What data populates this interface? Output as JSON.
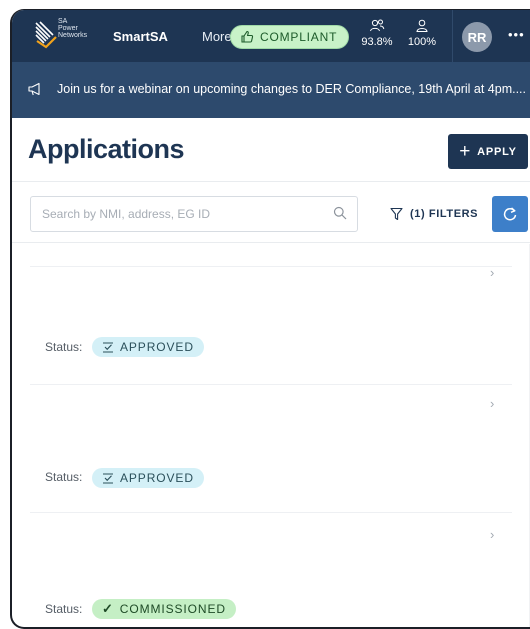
{
  "header": {
    "logo_text": [
      "SA",
      "Power",
      "Networks"
    ],
    "app_name": "SmartSA",
    "more_label": "More",
    "compliant_label": "COMPLIANT",
    "stats": [
      {
        "icon": "users-icon",
        "value": "93.8%"
      },
      {
        "icon": "user-icon",
        "value": "100%"
      }
    ],
    "avatar_initials": "RR",
    "menu_label": "•••"
  },
  "banner": {
    "icon": "megaphone-icon",
    "text": "Join us for a webinar on upcoming changes to DER Compliance, 19th April at 4pm...."
  },
  "page": {
    "title": "Applications",
    "apply_label": "APPLY"
  },
  "search": {
    "placeholder": "Search by NMI, address, EG ID",
    "value": ""
  },
  "filters": {
    "label": "(1) FILTERS"
  },
  "applications": [
    {
      "status_label": "Status:",
      "status": "APPROVED",
      "status_color": "#d4f0f7"
    },
    {
      "status_label": "Status:",
      "status": "APPROVED",
      "status_color": "#d4f0f7"
    },
    {
      "status_label": "Status:",
      "status": "COMMISSIONED",
      "status_color": "#c5efc5"
    }
  ],
  "colors": {
    "header_bg": "#1e3553",
    "banner_bg": "#2d4a6d",
    "accent": "#3d7fc9",
    "compliant_bg": "#c8f2c8"
  }
}
